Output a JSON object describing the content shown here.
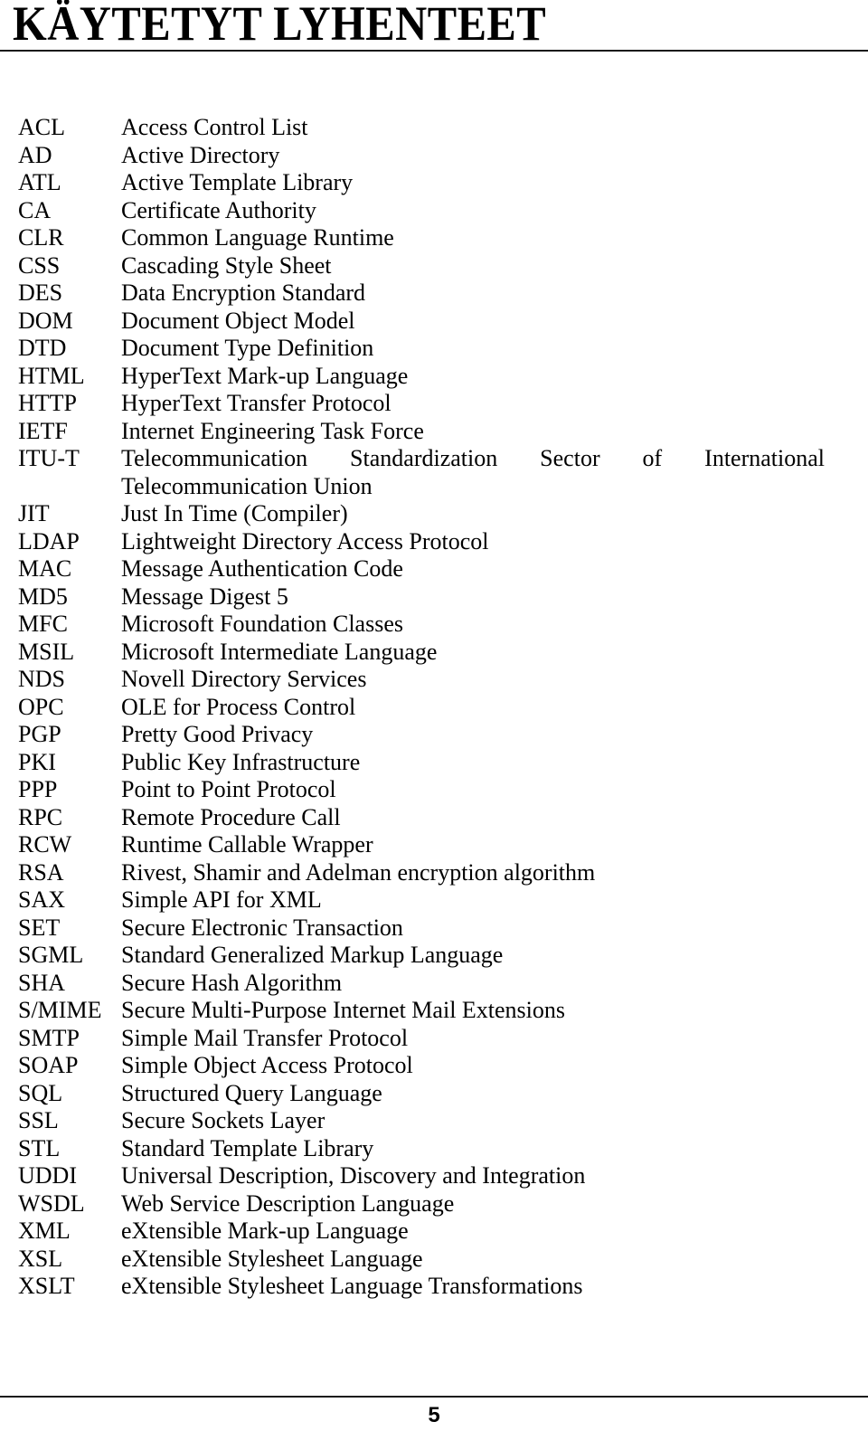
{
  "document": {
    "title": "KÄYTETYT LYHENTEET",
    "page_number": "5"
  },
  "abbreviations": [
    {
      "term": "ACL",
      "definition": "Access Control List"
    },
    {
      "term": "AD",
      "definition": "Active Directory"
    },
    {
      "term": "ATL",
      "definition": "Active Template Library"
    },
    {
      "term": "CA",
      "definition": "Certificate Authority"
    },
    {
      "term": "CLR",
      "definition": "Common Language Runtime"
    },
    {
      "term": "CSS",
      "definition": "Cascading Style Sheet"
    },
    {
      "term": "DES",
      "definition": "Data Encryption Standard"
    },
    {
      "term": "DOM",
      "definition": "Document Object Model"
    },
    {
      "term": "DTD",
      "definition": "Document Type Definition"
    },
    {
      "term": "HTML",
      "definition": "HyperText Mark-up Language"
    },
    {
      "term": "HTTP",
      "definition": "HyperText Transfer Protocol"
    },
    {
      "term": "IETF",
      "definition": "Internet Engineering Task Force"
    },
    {
      "term": "ITU-T",
      "definition": "Telecommunication Standardization Sector of International Telecommunication Union",
      "definition_line1": "Telecommunication Standardization Sector of International",
      "definition_line2": "Telecommunication Union",
      "justified": true
    },
    {
      "term": "JIT",
      "definition": "Just In Time (Compiler)"
    },
    {
      "term": "LDAP",
      "definition": "Lightweight Directory Access Protocol"
    },
    {
      "term": "MAC",
      "definition": "Message Authentication Code"
    },
    {
      "term": "MD5",
      "definition": "Message Digest 5"
    },
    {
      "term": "MFC",
      "definition": "Microsoft Foundation Classes"
    },
    {
      "term": "MSIL",
      "definition": "Microsoft Intermediate Language"
    },
    {
      "term": "NDS",
      "definition": "Novell Directory Services"
    },
    {
      "term": "OPC",
      "definition": "OLE for Process Control"
    },
    {
      "term": "PGP",
      "definition": "Pretty Good Privacy"
    },
    {
      "term": "PKI",
      "definition": "Public Key Infrastructure"
    },
    {
      "term": "PPP",
      "definition": "Point to Point Protocol"
    },
    {
      "term": "RPC",
      "definition": "Remote Procedure Call"
    },
    {
      "term": "RCW",
      "definition": "Runtime Callable Wrapper"
    },
    {
      "term": "RSA",
      "definition": "Rivest, Shamir and Adelman encryption algorithm"
    },
    {
      "term": "SAX",
      "definition": "Simple API for XML"
    },
    {
      "term": "SET",
      "definition": "Secure Electronic Transaction"
    },
    {
      "term": "SGML",
      "definition": "Standard Generalized Markup Language"
    },
    {
      "term": "SHA",
      "definition": "Secure Hash Algorithm"
    },
    {
      "term": "S/MIME",
      "definition": "Secure Multi-Purpose Internet Mail Extensions"
    },
    {
      "term": "SMTP",
      "definition": "Simple Mail Transfer Protocol"
    },
    {
      "term": "SOAP",
      "definition": "Simple Object Access Protocol"
    },
    {
      "term": "SQL",
      "definition": "Structured Query Language"
    },
    {
      "term": "SSL",
      "definition": "Secure Sockets Layer"
    },
    {
      "term": "STL",
      "definition": "Standard Template Library"
    },
    {
      "term": "UDDI",
      "definition": "Universal Description, Discovery and Integration"
    },
    {
      "term": "WSDL",
      "definition": "Web Service Description Language"
    },
    {
      "term": "XML",
      "definition": "eXtensible Mark-up Language"
    },
    {
      "term": "XSL",
      "definition": "eXtensible Stylesheet Language"
    },
    {
      "term": "XSLT",
      "definition": "eXtensible Stylesheet Language Transformations"
    }
  ]
}
